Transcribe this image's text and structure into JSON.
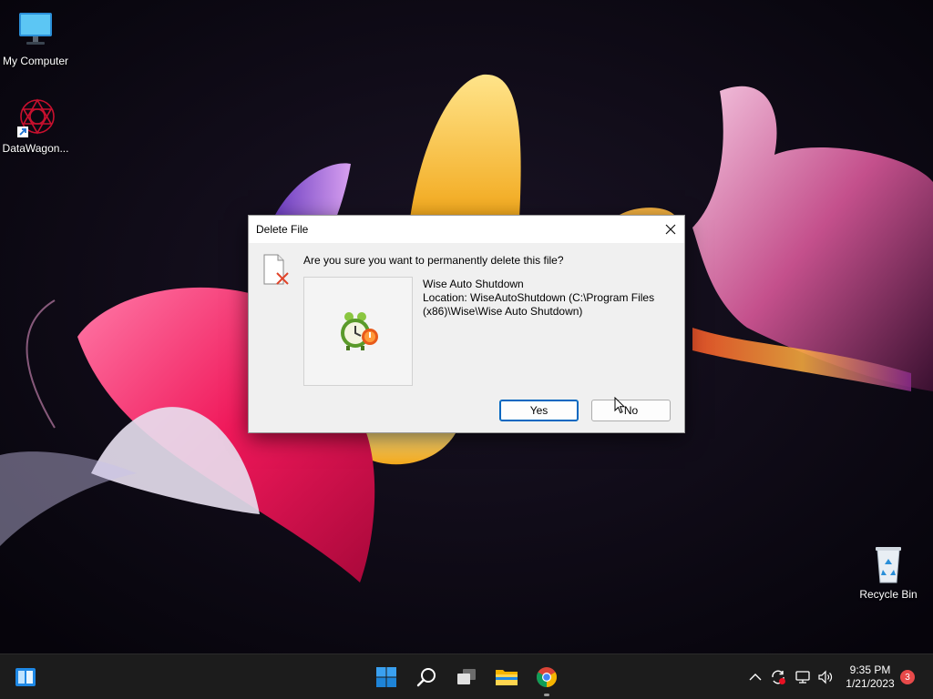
{
  "desktop": {
    "icons": [
      {
        "label": "My Computer",
        "icon": "monitor-icon"
      },
      {
        "label": "DataWagon...",
        "icon": "datawagon-shortcut-icon"
      },
      {
        "label": "Recycle Bin",
        "icon": "recycle-bin-icon"
      }
    ]
  },
  "dialog": {
    "title": "Delete File",
    "question": "Are you sure you want to permanently delete this file?",
    "file_name": "Wise Auto Shutdown",
    "location_line1": "Location: WiseAutoShutdown (C:\\Program Files",
    "location_line2": "(x86)\\Wise\\Wise Auto Shutdown)",
    "yes_label": "Yes",
    "no_label": "No",
    "close_icon": "close-icon",
    "accent": "#0067c0"
  },
  "taskbar": {
    "items": [
      "widgets-icon",
      "start-icon",
      "search-icon",
      "task-view-icon",
      "file-explorer-icon",
      "chrome-icon"
    ],
    "tray": [
      "chevron-up-icon",
      "sync-icon",
      "network-icon",
      "volume-icon"
    ],
    "time": "9:35 PM",
    "date": "1/21/2023",
    "notification_count": "3"
  }
}
